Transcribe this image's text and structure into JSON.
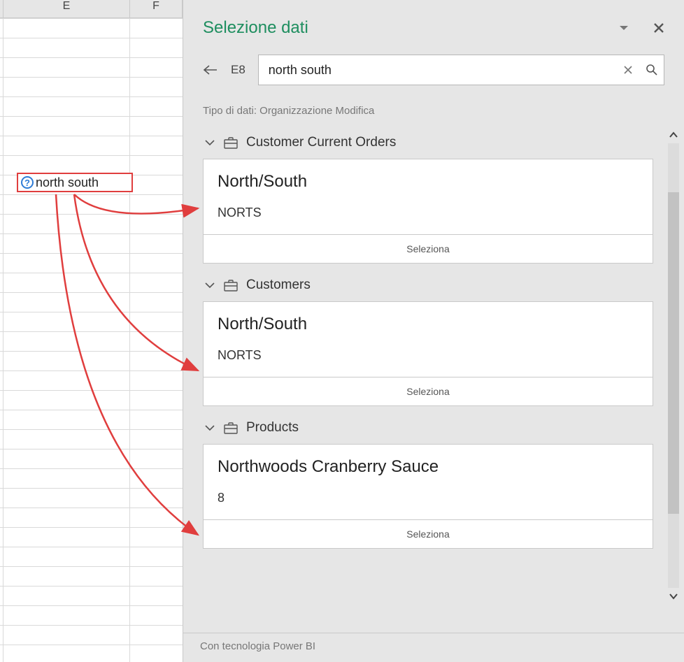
{
  "sheet": {
    "columns": [
      "E",
      "F"
    ],
    "selected_cell_value": "north south"
  },
  "pane": {
    "title": "Selezione dati",
    "cell_ref": "E8",
    "search_value": "north south",
    "datatype_line": "Tipo di dati: Organizzazione Modifica",
    "footer": "Con tecnologia Power BI",
    "groups": [
      {
        "name": "Customer Current Orders",
        "item": {
          "title": "North/South",
          "sub": "NORTS",
          "select_label": "Seleziona"
        }
      },
      {
        "name": "Customers",
        "item": {
          "title": "North/South",
          "sub": "NORTS",
          "select_label": "Seleziona"
        }
      },
      {
        "name": "Products",
        "item": {
          "title": "Northwoods Cranberry Sauce",
          "sub": "8",
          "select_label": "Seleziona"
        }
      }
    ]
  }
}
